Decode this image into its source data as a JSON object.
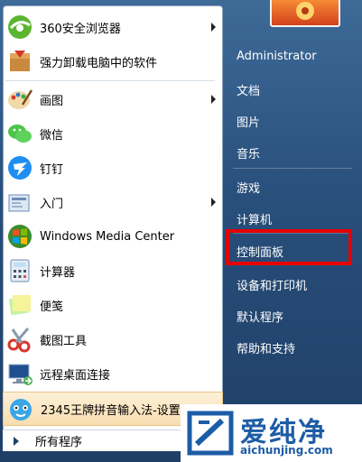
{
  "left_items": [
    {
      "label": "360安全浏览器",
      "icon": "360-browser-icon",
      "arrow": true
    },
    {
      "label": "强力卸载电脑中的软件",
      "icon": "uninstall-box-icon",
      "arrow": false
    },
    {
      "label": "画图",
      "icon": "paint-palette-icon",
      "arrow": true
    },
    {
      "label": "微信",
      "icon": "wechat-icon",
      "arrow": false
    },
    {
      "label": "钉钉",
      "icon": "dingtalk-icon",
      "arrow": false
    },
    {
      "label": "入门",
      "icon": "getting-started-icon",
      "arrow": true
    },
    {
      "label": "Windows Media Center",
      "icon": "media-center-icon",
      "arrow": false
    },
    {
      "label": "计算器",
      "icon": "calculator-icon",
      "arrow": false
    },
    {
      "label": "便笺",
      "icon": "sticky-notes-icon",
      "arrow": false
    },
    {
      "label": "截图工具",
      "icon": "snipping-tool-icon",
      "arrow": false
    },
    {
      "label": "远程桌面连接",
      "icon": "remote-desktop-icon",
      "arrow": false
    },
    {
      "label": "2345王牌拼音输入法-设置",
      "icon": "input-method-icon",
      "arrow": false
    }
  ],
  "all_programs": "所有程序",
  "right_items": [
    {
      "label": "Administrator"
    },
    {
      "label": "文档"
    },
    {
      "label": "图片"
    },
    {
      "label": "音乐"
    },
    {
      "label": "游戏"
    },
    {
      "label": "计算机"
    },
    {
      "label": "控制面板"
    },
    {
      "label": "设备和打印机"
    },
    {
      "label": "默认程序"
    },
    {
      "label": "帮助和支持"
    }
  ],
  "watermark": {
    "title": "爱纯净",
    "url": "aichunjing.com"
  },
  "colors": {
    "highlight_box": "#e60000",
    "menu_right_bg": "#2c5480",
    "watermark": "#1d5ca6"
  }
}
